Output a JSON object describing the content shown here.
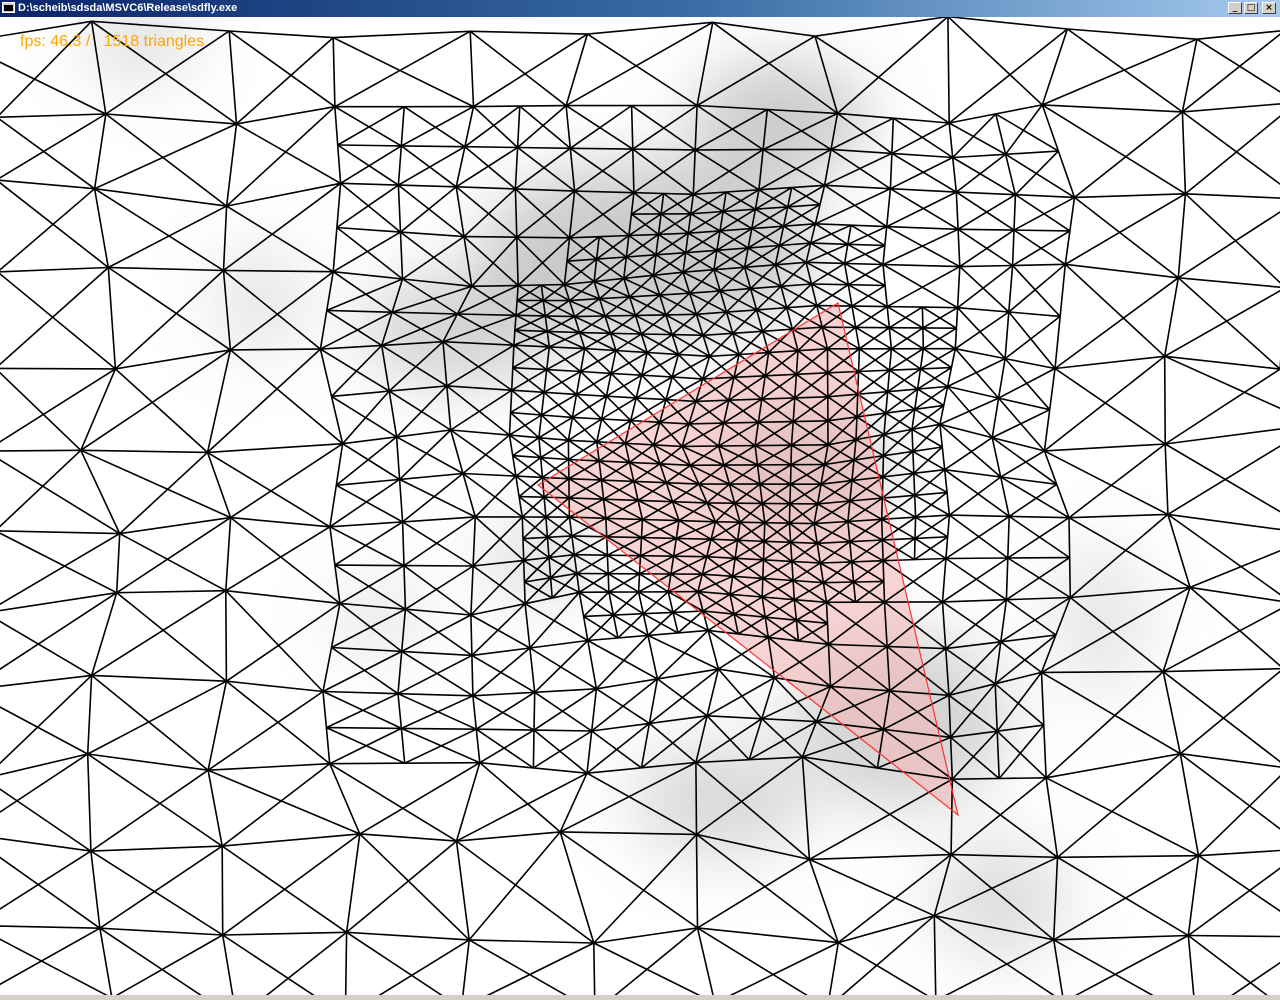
{
  "window": {
    "title": "D:\\scheib\\sdsda\\MSVC6\\Release\\sdfly.exe",
    "icon": "console-app-icon",
    "buttons": {
      "minimize": "_",
      "maximize": "□",
      "close": "×"
    }
  },
  "hud": {
    "fps_label": "fps: ",
    "fps_value": "46.3",
    "separator": " /   ",
    "triangle_count": "1518",
    "triangle_label": " triangles"
  },
  "colors": {
    "hud_text": "#ffa500",
    "mesh_lines": "#000000",
    "highlight_fill": "#f5b8b8",
    "highlight_stroke": "#ff3333",
    "terrain_shade": "#a0a0a0"
  }
}
